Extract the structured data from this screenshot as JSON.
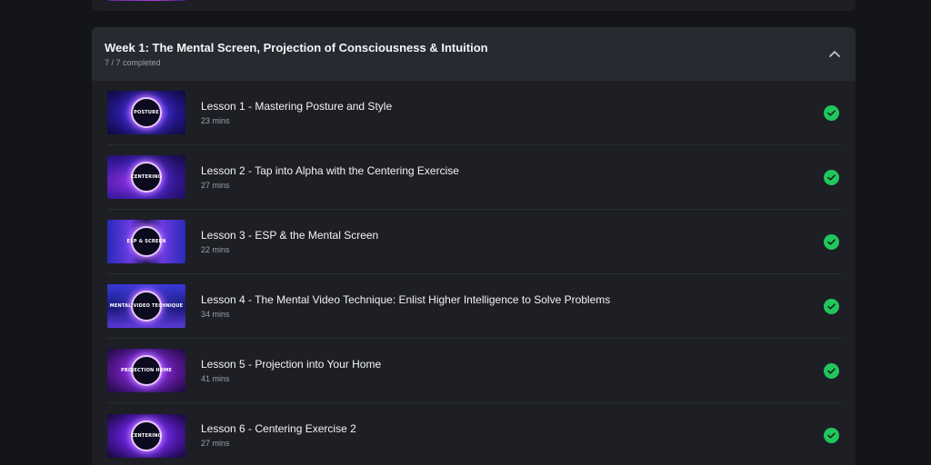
{
  "module": {
    "title": "Week 1: The Mental Screen, Projection of Consciousness & Intuition",
    "progress": "7 / 7 completed",
    "collapse_icon": "chevron-up-icon"
  },
  "lessons": [
    {
      "title": "Lesson 1 - Mastering Posture and Style",
      "duration": "23 mins",
      "thumb_text": "POSTURE",
      "completed": true,
      "status_icon": "check-circle-icon"
    },
    {
      "title": "Lesson 2 - Tap into Alpha with the Centering Exercise",
      "duration": "27 mins",
      "thumb_text": "CENTERING",
      "completed": true,
      "status_icon": "check-circle-icon"
    },
    {
      "title": "Lesson 3 - ESP & the Mental Screen",
      "duration": "22 mins",
      "thumb_text": "ESP & SCREEN",
      "completed": true,
      "status_icon": "check-circle-icon"
    },
    {
      "title": "Lesson 4 - The Mental Video Technique: Enlist Higher Intelligence to Solve Problems",
      "duration": "34 mins",
      "thumb_text": "MENTAL VIDEO TECHNIQUE",
      "completed": true,
      "status_icon": "check-circle-icon"
    },
    {
      "title": "Lesson 5 - Projection into Your Home",
      "duration": "41 mins",
      "thumb_text": "PROJECTION HOME",
      "completed": true,
      "status_icon": "check-circle-icon"
    },
    {
      "title": "Lesson 6 - Centering Exercise 2",
      "duration": "27 mins",
      "thumb_text": "CENTERING",
      "completed": true,
      "status_icon": "check-circle-icon"
    }
  ],
  "colors": {
    "background": "#141518",
    "card": "#1d1f24",
    "header": "#272a30",
    "check": "#22c55e"
  }
}
